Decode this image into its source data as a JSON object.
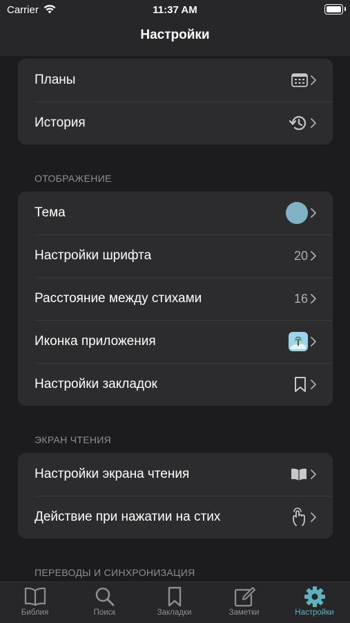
{
  "status": {
    "carrier": "Carrier",
    "time": "11:37 AM"
  },
  "nav": {
    "title": "Настройки"
  },
  "groups": {
    "general": {
      "items": [
        {
          "label": "Планы"
        },
        {
          "label": "История"
        }
      ]
    },
    "display": {
      "header": "ОТОБРАЖЕНИЕ",
      "items": [
        {
          "label": "Тема",
          "color": "#7fb3c4"
        },
        {
          "label": "Настройки шрифта",
          "value": "20"
        },
        {
          "label": "Расстояние между стихами",
          "value": "16"
        },
        {
          "label": "Иконка приложения"
        },
        {
          "label": "Настройки закладок"
        }
      ]
    },
    "reading": {
      "header": "ЭКРАН ЧТЕНИЯ",
      "items": [
        {
          "label": "Настройки экрана чтения"
        },
        {
          "label": "Действие при нажатии на стих"
        }
      ]
    },
    "translations": {
      "header": "ПЕРЕВОДЫ И СИНХРОНИЗАЦИЯ"
    }
  },
  "tabs": [
    {
      "label": "Библия",
      "icon": "book-icon"
    },
    {
      "label": "Поиск",
      "icon": "search-icon"
    },
    {
      "label": "Закладки",
      "icon": "bookmark-icon"
    },
    {
      "label": "Заметки",
      "icon": "note-icon"
    },
    {
      "label": "Настройки",
      "icon": "gear-icon",
      "active": true
    }
  ],
  "colors": {
    "accent": "#5cb3c0",
    "background": "#1c1c1e",
    "cell": "#2c2c2e"
  }
}
